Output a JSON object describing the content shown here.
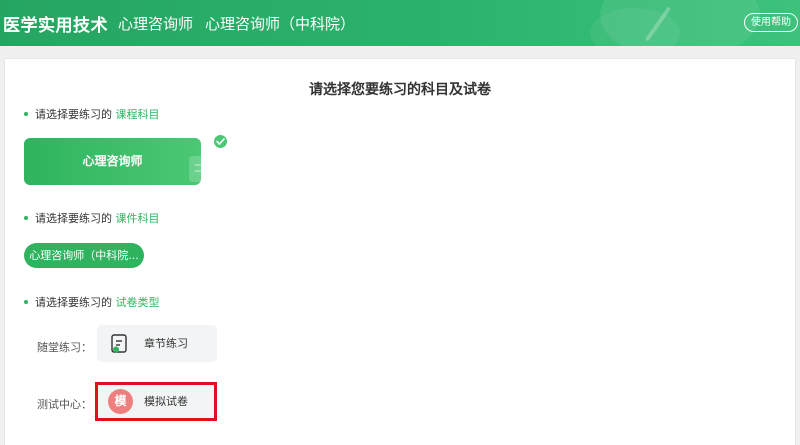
{
  "header": {
    "app_title": "医学实用技术",
    "crumbs": [
      "心理咨询师",
      "心理咨询师（中科院）"
    ],
    "help_button": "使用帮助"
  },
  "main": {
    "page_title": "请选择您要练习的科目及试卷",
    "sections": [
      {
        "prefix": "请选择要练习的",
        "highlight": "课程科目"
      },
      {
        "prefix": "请选择要练习的",
        "highlight": "课件科目"
      },
      {
        "prefix": "请选择要练习的",
        "highlight": "试卷类型"
      }
    ],
    "subject_card": {
      "label": "心理咨询师",
      "selected": true
    },
    "course_pill": {
      "label": "心理咨询师（中科院..."
    },
    "paper_types": [
      {
        "row_label": "随堂练习：",
        "card_label": "章节练习",
        "icon": "document-icon"
      },
      {
        "row_label": "测试中心：",
        "card_label": "模拟试卷",
        "icon_text": "模",
        "icon": "mock-exam-badge-icon"
      }
    ]
  },
  "colors": {
    "brand_green": "#2fb35f",
    "header_green": "#25a561",
    "mock_badge": "#ef7f7f",
    "highlight_red": "#e0101d"
  }
}
